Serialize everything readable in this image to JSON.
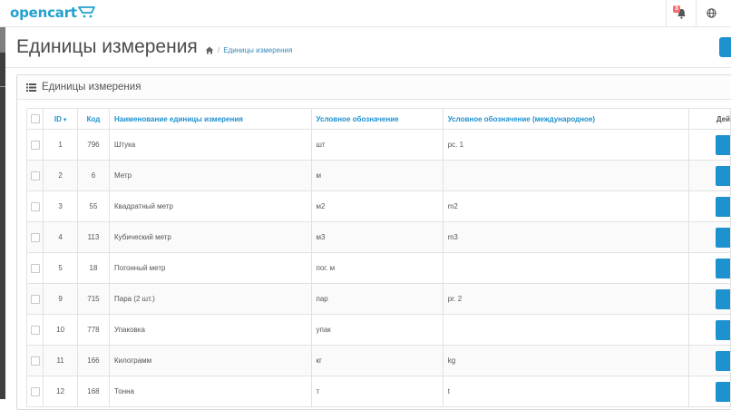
{
  "header": {
    "logo_text": "opencart",
    "notification_count": "3"
  },
  "page": {
    "title": "Единицы измерения",
    "breadcrumb": [
      "Единицы измерения"
    ]
  },
  "panel": {
    "title": "Единицы измерения"
  },
  "table": {
    "columns": {
      "id": "ID",
      "code": "Код",
      "name": "Наименование единицы измерения",
      "symbol": "Условное обозначение",
      "symbol_intl": "Условное обозначение (международное)",
      "actions": "Дей"
    },
    "rows": [
      {
        "id": "1",
        "code": "796",
        "name": "Штука",
        "symbol": "шт",
        "symbol_intl": "pc. 1"
      },
      {
        "id": "2",
        "code": "6",
        "name": "Метр",
        "symbol": "м",
        "symbol_intl": ""
      },
      {
        "id": "3",
        "code": "55",
        "name": "Квадратный метр",
        "symbol": "м2",
        "symbol_intl": "m2"
      },
      {
        "id": "4",
        "code": "113",
        "name": "Кубический метр",
        "symbol": "м3",
        "symbol_intl": "m3"
      },
      {
        "id": "5",
        "code": "18",
        "name": "Погонный метр",
        "symbol": "пог. м",
        "symbol_intl": ""
      },
      {
        "id": "9",
        "code": "715",
        "name": "Пара (2 шт.)",
        "symbol": "пар",
        "symbol_intl": "pr. 2"
      },
      {
        "id": "10",
        "code": "778",
        "name": "Упаковка",
        "symbol": "упак",
        "symbol_intl": ""
      },
      {
        "id": "11",
        "code": "166",
        "name": "Килограмм",
        "symbol": "кг",
        "symbol_intl": "kg"
      },
      {
        "id": "12",
        "code": "168",
        "name": "Тонна",
        "symbol": "т",
        "symbol_intl": "t"
      }
    ]
  },
  "colors": {
    "accent": "#1e91cf",
    "logo": "#23a1d1",
    "badge": "#f56b6b"
  }
}
